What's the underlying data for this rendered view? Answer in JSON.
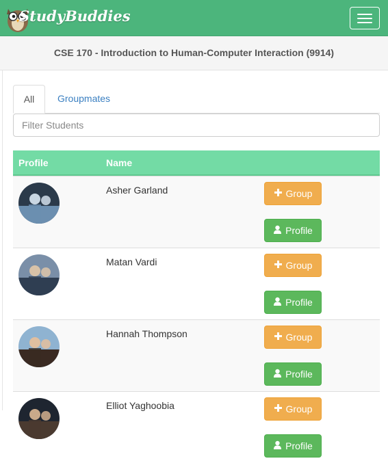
{
  "app": {
    "brand": "StudyBuddies",
    "accent_color": "#4cb57c",
    "header_color": "#73dba5"
  },
  "navbar": {
    "menu_icon": "hamburger-icon",
    "logo_icon": "owl-logo-icon"
  },
  "course": {
    "title": "CSE 170 - Introduction to Human-Computer Interaction (9914)"
  },
  "tabs": [
    {
      "label": "All",
      "active": true
    },
    {
      "label": "Groupmates",
      "active": false
    }
  ],
  "filter": {
    "placeholder": "Filter Students",
    "value": ""
  },
  "table": {
    "columns": [
      "Profile",
      "Name"
    ],
    "rows": [
      {
        "name": "Asher Garland",
        "group_label": "Group",
        "profile_label": "Profile",
        "avatar_palette": [
          "#2b3a4a",
          "#6c8fb0",
          "#c9d6e2"
        ]
      },
      {
        "name": "Matan Vardi",
        "group_label": "Group",
        "profile_label": "Profile",
        "avatar_palette": [
          "#7a8fa8",
          "#2f3e52",
          "#d8c2a8"
        ]
      },
      {
        "name": "Hannah Thompson",
        "group_label": "Group",
        "profile_label": "Profile",
        "avatar_palette": [
          "#8fb3d1",
          "#3a2a22",
          "#e0bfa0"
        ]
      },
      {
        "name": "Elliot Yaghoobia",
        "group_label": "Group",
        "profile_label": "Profile",
        "avatar_palette": [
          "#1e2530",
          "#4a3a30",
          "#c9a98a"
        ]
      }
    ],
    "icons": {
      "group": "plus-icon",
      "profile": "user-icon"
    }
  }
}
